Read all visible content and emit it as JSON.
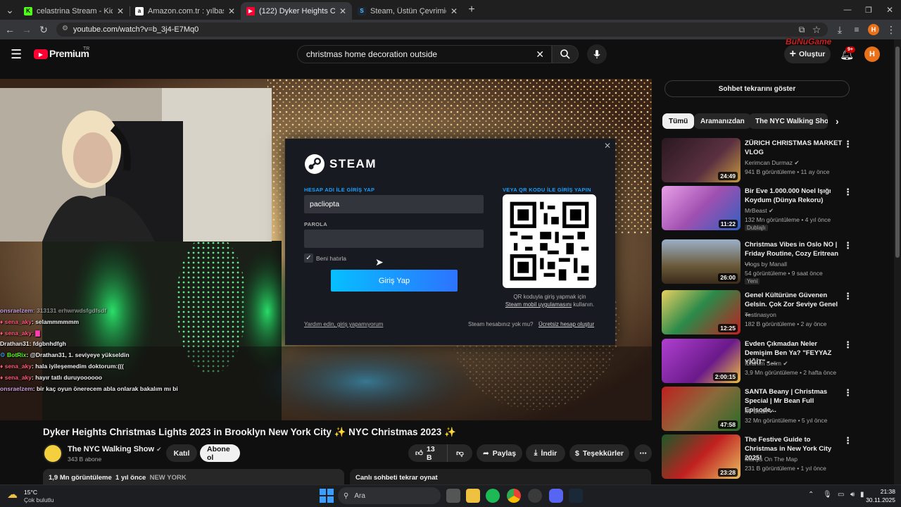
{
  "browser": {
    "tabs": [
      {
        "title": "celastrina Stream - Kick Dashbo",
        "favicon": "kick-icon"
      },
      {
        "title": "Amazon.com.tr : yılbaşı ağacı",
        "favicon": "amazon-icon"
      },
      {
        "title": "(122) Dyker Heights Christmas",
        "favicon": "youtube-icon"
      },
      {
        "title": "Steam, Üstün Çevrimiçi Oyun P",
        "favicon": "steam-icon"
      }
    ],
    "url": "youtube.com/watch?v=b_3j4-E7Mq0",
    "profile_initial": "H"
  },
  "youtube": {
    "logo_text": "Premium",
    "region": "TR",
    "search_query": "christmas home decoration outside",
    "create_label": "Oluştur",
    "notif_count": "9+",
    "avatar_initial": "H",
    "watermark": "BuNuGame",
    "video": {
      "title": "Dyker Heights Christmas Lights 2023 in Brooklyn New York City ✨ NYC Christmas 2023 ✨",
      "channel": "The NYC Walking Show",
      "subs": "343 B abone",
      "join": "Katıl",
      "subscribe": "Abone ol",
      "likes": "13 B",
      "share": "Paylaş",
      "download": "İndir",
      "thanks": "Teşekkürler",
      "views": "1,9 Mn görüntüleme",
      "age": "1 yıl önce",
      "location": "NEW YORK",
      "live_chat_replay": "Canlı sohbeti tekrar oynat"
    },
    "chat_replay_btn": "Sohbet tekrarını göster",
    "chips": [
      "Tümü",
      "Aramanızdan",
      "The NYC Walking Show"
    ],
    "recommendations": [
      {
        "title": "ZÜRICH CHRISTMAS MARKET VLOG",
        "channel": "Kerimcan Durmaz",
        "verified": "✔",
        "meta": "941 B görüntüleme • 11 ay önce",
        "duration": "24:49",
        "badge": "",
        "thumb_color": "#4a2a30"
      },
      {
        "title": "Bir Eve 1.000.000 Noel Işığı Koydum (Dünya Rekoru)",
        "channel": "MrBeast",
        "verified": "✔",
        "meta": "132 Mn görüntüleme • 4 yıl önce",
        "duration": "11:22",
        "badge": "Dublajlı",
        "thumb_color": "#c87ac8"
      },
      {
        "title": "Christmas Vibes in Oslo NO | Friday Routine, Cozy Eritrean ...",
        "channel": "Vlogs by Manall",
        "verified": "",
        "meta": "54 görüntüleme • 9 saat önce",
        "duration": "26:00",
        "badge": "Yeni",
        "thumb_color": "#6a5a3a"
      },
      {
        "title": "Genel Kültürüne Güvenen Gelsin. Çok Zor Seviye Genel ...",
        "channel": "Testinasyon",
        "verified": "",
        "meta": "182 B görüntüleme • 2 ay önce",
        "duration": "12:25",
        "badge": "",
        "thumb_color": "#2a6a3a"
      },
      {
        "title": "Evden Çıkmadan Neler Demişim Ben Ya? \"FEYYAZ YİĞİT\" - ...",
        "channel": "İbrahim Selim",
        "verified": "✔",
        "meta": "3,9 Mn görüntüleme • 2 hafta önce",
        "duration": "2:00:15",
        "badge": "",
        "thumb_color": "#7a2a9a"
      },
      {
        "title": "SANTA Beany | Christmas Special | Mr Bean Full Episode...",
        "channel": "Mr Bean",
        "verified": "✔",
        "meta": "32 Mn görüntüleme • 5 yıl önce",
        "duration": "47:58",
        "badge": "",
        "thumb_color": "#8a2020"
      },
      {
        "title": "The Festive Guide to Christmas in New York City 2025!",
        "channel": "Manps On The Map",
        "verified": "",
        "meta": "231 B görüntüleme • 1 yıl önce",
        "duration": "23:28",
        "badge": "",
        "thumb_color": "#7a1a1a"
      }
    ]
  },
  "steam": {
    "brand": "STEAM",
    "account_label": "HESAP ADI İLE GİRİŞ YAP",
    "username": "pacliopta",
    "password_label": "PAROLA",
    "remember": "Beni hatırla",
    "login_btn": "Giriş Yap",
    "qr_label": "VEYA QR KODU İLE GİRİŞ YAPIN",
    "qr_hint_1": "QR koduyla giriş yapmak için",
    "qr_hint_link": "Steam mobil uygulamasını",
    "qr_hint_2": "kullanın.",
    "help_link": "Yardım edin, giriş yapamıyorum",
    "no_account": "Steam hesabınız yok mu?",
    "create_link": "Ücretsiz hesap oluştur"
  },
  "chat": [
    {
      "user": "onsraelzem",
      "msg": ": 313131 erhwrwdsfgdfsdf",
      "color": "#c9a0dc",
      "badge": ""
    },
    {
      "user": "sena_aky",
      "msg": ": selammmmmm",
      "color": "#ff5a7a",
      "badge": "♦"
    },
    {
      "user": "sena_aky",
      "msg": ": ▇",
      "color": "#ff5a7a",
      "badge": "♦"
    },
    {
      "user": "Drathan31",
      "msg": ": fdgbnhdfgh",
      "color": "#ffffff",
      "badge": ""
    },
    {
      "user": "BotRix",
      "msg": ": @Drathan31, 1. seviyeye yükseldin",
      "color": "#53fc18",
      "badge": "⚙"
    },
    {
      "user": "sena_aky",
      "msg": ": hala iyileşemedim doktorum:(((",
      "color": "#ff5a7a",
      "badge": "♦"
    },
    {
      "user": "sena_aky",
      "msg": ": hayır tatlı duruyoooooo",
      "color": "#ff5a7a",
      "badge": "♦"
    },
    {
      "user": "onsraelzem",
      "msg": ": bir kaç oyun önerecem abla onlarak bakalım mı bi",
      "color": "#c9a0dc",
      "badge": ""
    }
  ],
  "taskbar": {
    "temp": "15°C",
    "weather": "Çok bulutlu",
    "search": "Ara",
    "time": "21:38",
    "date": "30.11.2025"
  }
}
